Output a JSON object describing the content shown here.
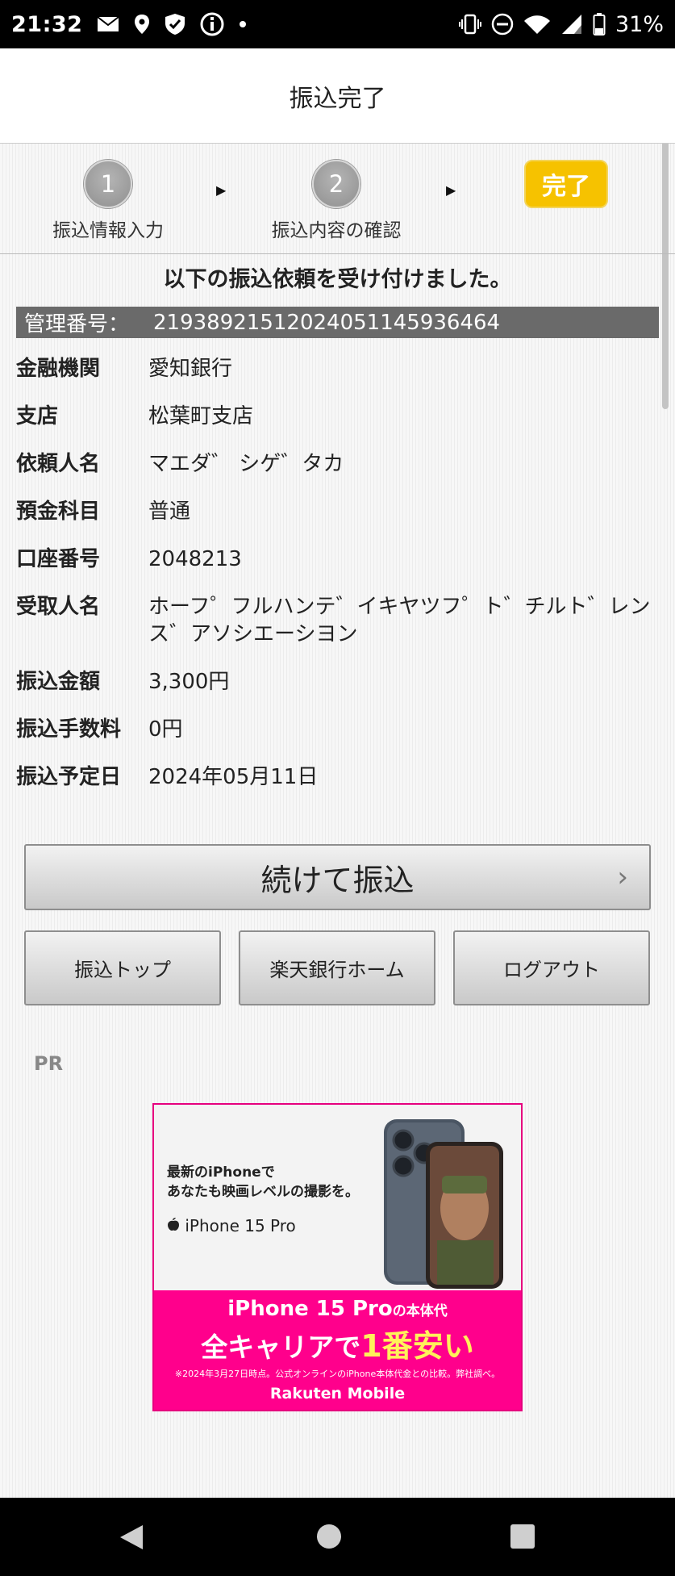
{
  "status_bar": {
    "time": "21:32",
    "battery": "31%"
  },
  "header": {
    "title": "振込完了"
  },
  "steps": [
    {
      "number": "1",
      "label": "振込情報入力"
    },
    {
      "number": "2",
      "label": "振込内容の確認"
    }
  ],
  "step_done_label": "完了",
  "notice": "以下の振込依頼を受け付けました。",
  "management": {
    "label": "管理番号：",
    "value": "21938921512024051145936464"
  },
  "details": {
    "bank": {
      "label": "金融機関",
      "value": "愛知銀行"
    },
    "branch": {
      "label": "支店",
      "value": "松葉町支店"
    },
    "requester": {
      "label": "依頼人名",
      "value": "マエダ゛ シゲ゛タカ"
    },
    "account_type": {
      "label": "預金科目",
      "value": "普通"
    },
    "account_number": {
      "label": "口座番号",
      "value": "2048213"
    },
    "recipient": {
      "label": "受取人名",
      "value": "ホーフ゜フルハンテ゛イキヤツフ゜ト゛チルト゛レンス゛アソシエーシヨン"
    },
    "amount": {
      "label": "振込金額",
      "value": "3,300円"
    },
    "fee": {
      "label": "振込手数料",
      "value": "0円"
    },
    "scheduled_date": {
      "label": "振込予定日",
      "value": "2024年05月11日"
    }
  },
  "buttons": {
    "continue": "続けて振込",
    "transfer_top": "振込トップ",
    "rakuten_home": "楽天銀行ホーム",
    "logout": "ログアウト"
  },
  "pr_label": "PR",
  "ad": {
    "copy_line1": "最新のiPhoneで",
    "copy_line2": "あなたも映画レベルの撮影を。",
    "model": "iPhone 15 Pro",
    "headline_main": "iPhone 15 Pro",
    "headline_suffix": "の本体代",
    "tagline_a": "全キャリアで",
    "tagline_b": "1番安い",
    "footnote": "※2024年3月27日時点。公式オンラインのiPhone本体代金との比較。弊社調べ。",
    "brand": "Rakuten Mobile",
    "colors": {
      "magenta": "#ff008c",
      "highlight": "#fff15a"
    }
  },
  "colors": {
    "accent_done": "#f6c200",
    "management_bar": "#6a6a6a"
  },
  "icons": [
    "mail-icon",
    "location-icon",
    "shield-icon",
    "info-icon",
    "vibrate-icon",
    "dnd-icon",
    "wifi-icon",
    "signal-icon",
    "battery-icon",
    "nav-back-icon",
    "nav-home-icon",
    "nav-recents-icon"
  ]
}
